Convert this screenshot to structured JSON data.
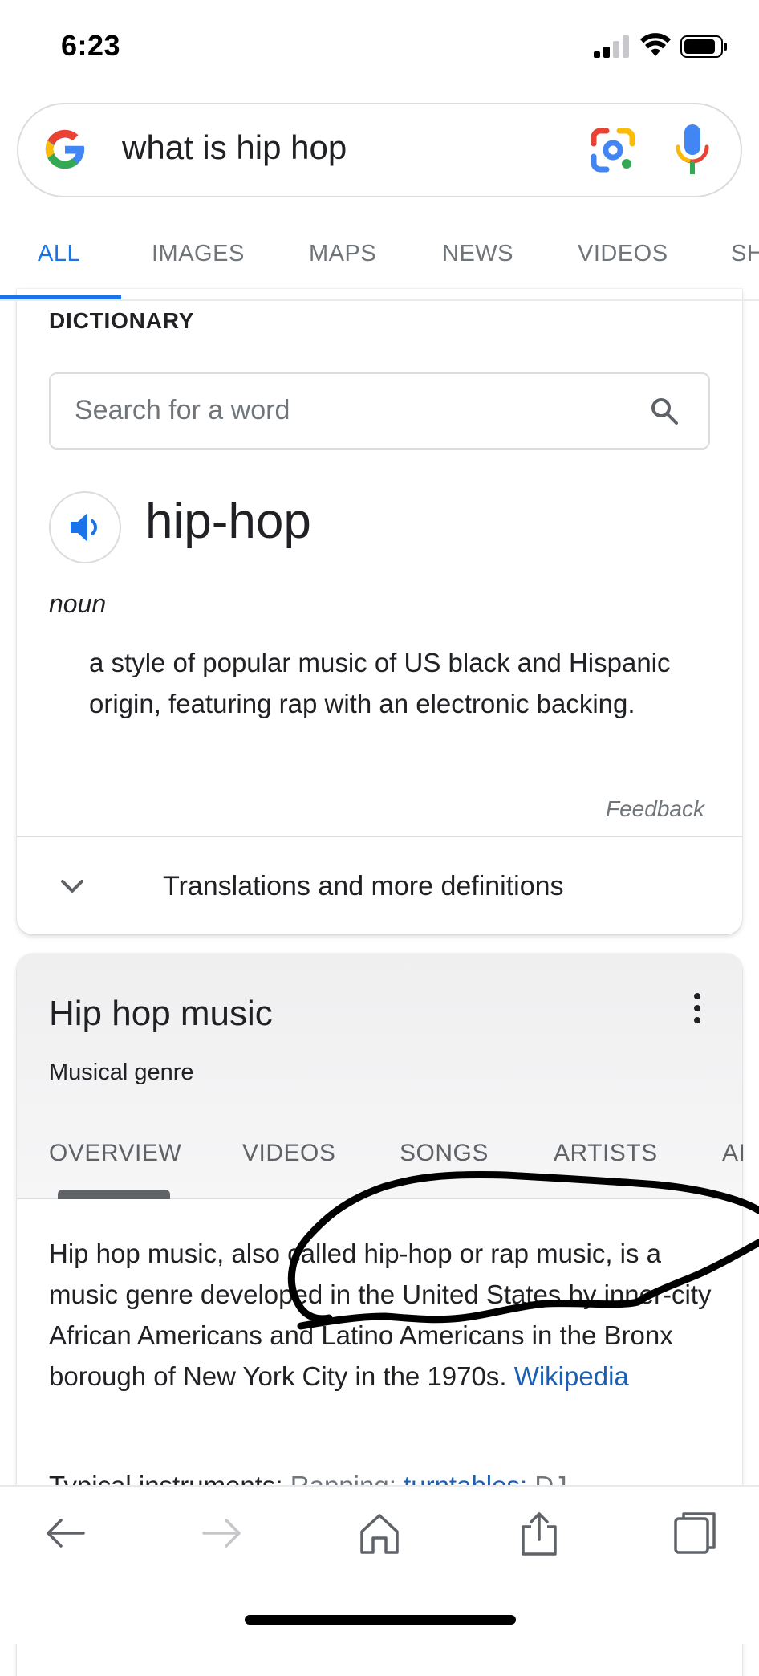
{
  "status_bar": {
    "time": "6:23"
  },
  "search": {
    "query": "what is hip hop",
    "icons": [
      "google-logo",
      "lens-icon",
      "mic-icon"
    ]
  },
  "tabs": [
    {
      "label": "ALL",
      "active": true
    },
    {
      "label": "IMAGES"
    },
    {
      "label": "MAPS"
    },
    {
      "label": "NEWS"
    },
    {
      "label": "VIDEOS"
    },
    {
      "label": "SH"
    }
  ],
  "dictionary": {
    "heading": "DICTIONARY",
    "search_placeholder": "Search for a word",
    "word": "hip-hop",
    "part_of_speech": "noun",
    "definition": "a style of popular music of US black and Hispanic origin, featuring rap with an electronic backing.",
    "feedback": "Feedback",
    "more_definitions": "Translations and more definitions"
  },
  "knowledge_panel": {
    "title": "Hip hop music",
    "subtitle": "Musical genre",
    "tabs": [
      "OVERVIEW",
      "VIDEOS",
      "SONGS",
      "ARTISTS",
      "AI"
    ],
    "active_tab": "OVERVIEW",
    "description": "Hip hop music, also called hip-hop or rap music, is a music genre developed in the United States by inner-city African Americans and Latino Americans in the Bronx borough of New York City in the 1970s.",
    "source_link": "Wikipedia",
    "next_line": {
      "label": "Typical instruments:",
      "item1": "Rapping;",
      "item2": "turntables;",
      "item3": "DJ"
    }
  },
  "colors": {
    "accent": "#1a73e8",
    "link": "#1a5fb4",
    "muted": "#70757a",
    "text": "#202124"
  },
  "toolbar": {
    "icons": [
      "back-arrow-icon",
      "forward-arrow-icon",
      "home-icon",
      "share-icon",
      "tabs-icon"
    ]
  }
}
